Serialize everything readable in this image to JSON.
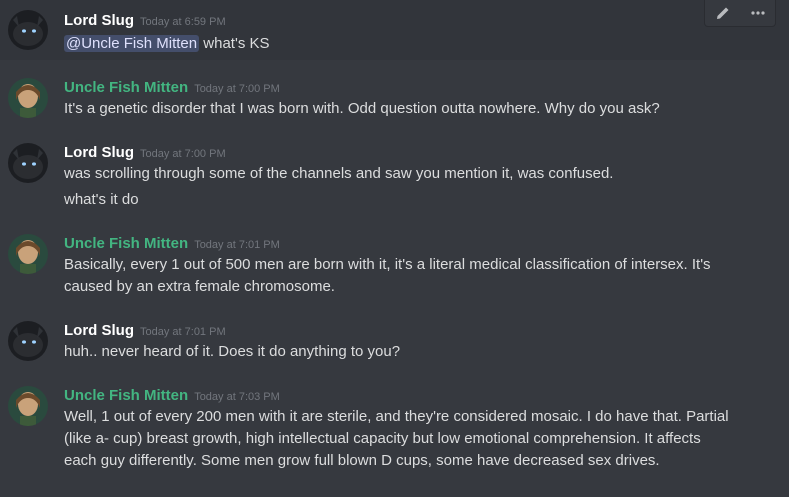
{
  "messages": [
    {
      "username": "Lord Slug",
      "timestamp": "Today at 6:59 PM",
      "mention": "@Uncle Fish Mitten",
      "lines": [
        " what's KS"
      ]
    },
    {
      "username": "Uncle Fish Mitten",
      "timestamp": "Today at 7:00 PM",
      "lines": [
        "It's a genetic disorder that I was born with. Odd question outta nowhere. Why do you ask?"
      ]
    },
    {
      "username": "Lord Slug",
      "timestamp": "Today at 7:00 PM",
      "lines": [
        "was scrolling through some of the channels and saw you mention it, was confused.",
        "what's it do"
      ]
    },
    {
      "username": "Uncle Fish Mitten",
      "timestamp": "Today at 7:01 PM",
      "lines": [
        "Basically, every 1 out of 500 men are born with it, it's a literal medical classification of intersex. It's",
        "caused by an extra female chromosome."
      ]
    },
    {
      "username": "Lord Slug",
      "timestamp": "Today at 7:01 PM",
      "lines": [
        "huh.. never heard of it.  Does it do anything to you?"
      ]
    },
    {
      "username": "Uncle Fish Mitten",
      "timestamp": "Today at 7:03 PM",
      "lines": [
        "Well, 1 out of every 200 men with it are sterile, and they're considered mosaic. I do have that. Partial",
        "(like a- cup) breast growth, high intellectual capacity but low emotional comprehension. It affects",
        "each guy differently. Some men grow full blown D cups, some have decreased sex drives."
      ]
    }
  ],
  "toolbar": {
    "edit_icon": "pencil-icon",
    "more_icon": "more-icon"
  },
  "colors": {
    "background": "#36393f",
    "fish_name": "#43b581",
    "slug_name": "#ffffff",
    "timestamp": "#72767d",
    "mention_bg": "#414675"
  }
}
